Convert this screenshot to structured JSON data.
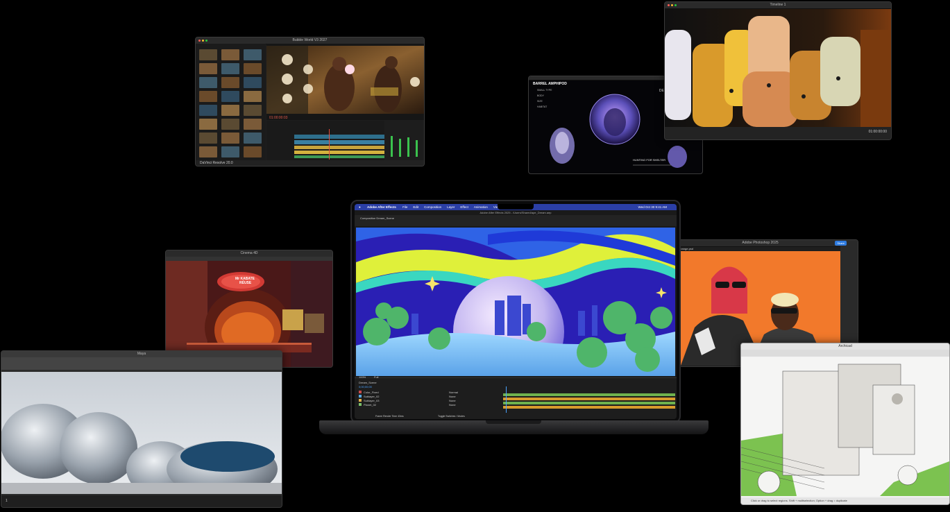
{
  "davinci": {
    "title": "Bubble World V3 2027",
    "app_name": "DaVinci Resolve 20.0",
    "timecode": "01:00:00:03",
    "bin_label": "Master"
  },
  "fcp": {
    "title": "Timeline 1",
    "timecode": "00:00:00:00",
    "timecode_right": "01:00:00:00"
  },
  "article": {
    "heading": "BARREL AMPHIPOD",
    "items": [
      "SMALL TYPE",
      "BODY",
      "SIZE",
      "HABITAT"
    ],
    "right_title": "DESCRIPTION",
    "caption_title": "HUNTING FOR SHELTER",
    "caption_body": "IT USES THE CARCASSES OF OTHER ORGANISMS AS PROTECTION"
  },
  "c4d": {
    "title": "Cinema 4D",
    "sign_text_1": "Mr KABATE",
    "sign_text_2": "RÉUSE"
  },
  "maya": {
    "title": "Maya",
    "frame_label": "1"
  },
  "aftereffects": {
    "menubar": {
      "app": "Adobe After Effects",
      "items": [
        "File",
        "Edit",
        "Composition",
        "Layer",
        "Effect",
        "Animation",
        "View",
        "Window",
        "Help"
      ],
      "clock": "Wed Oct 30 9:41 AM"
    },
    "doc_title": "Adobe After Effects 2025 - /Users/Shared/ape_Dream.aep",
    "comp_tab": "Composition Dream_Scene",
    "comp_subtabs": [
      "Dream_Scene",
      "Main_Scene",
      "PEG_car"
    ],
    "zoom": "100%",
    "quality": "Full",
    "timeline_tab": "Dream_Scene",
    "timecode": "0;00;00;00",
    "layers": [
      {
        "name": "Color_Fixed",
        "mode": "Normal"
      },
      {
        "name": "Sublayer_02",
        "mode": "None"
      },
      {
        "name": "Sublayer_03",
        "mode": "None"
      },
      {
        "name": "Planet_02",
        "mode": "None"
      }
    ],
    "footer_left": "Frame Render Time 43ms",
    "footer_right": "Toggle Switches / Modes"
  },
  "photoshop": {
    "title": "Adobe Photoshop 2025",
    "share_label": "Share",
    "doc_tab": "Portrait_Orange.psd"
  },
  "archicad": {
    "title": "Archicad",
    "status": "Click or drag to select regions. Shift + multiselection; Option + drag = duplicate"
  },
  "colors": {
    "ae_menubar": "#2b3fa6",
    "ae_purple_sky": "#2a1fb4",
    "ae_orange_bg": "#f2792b",
    "timeline_green": "#6fb24e",
    "timeline_orange": "#d89b2c"
  }
}
